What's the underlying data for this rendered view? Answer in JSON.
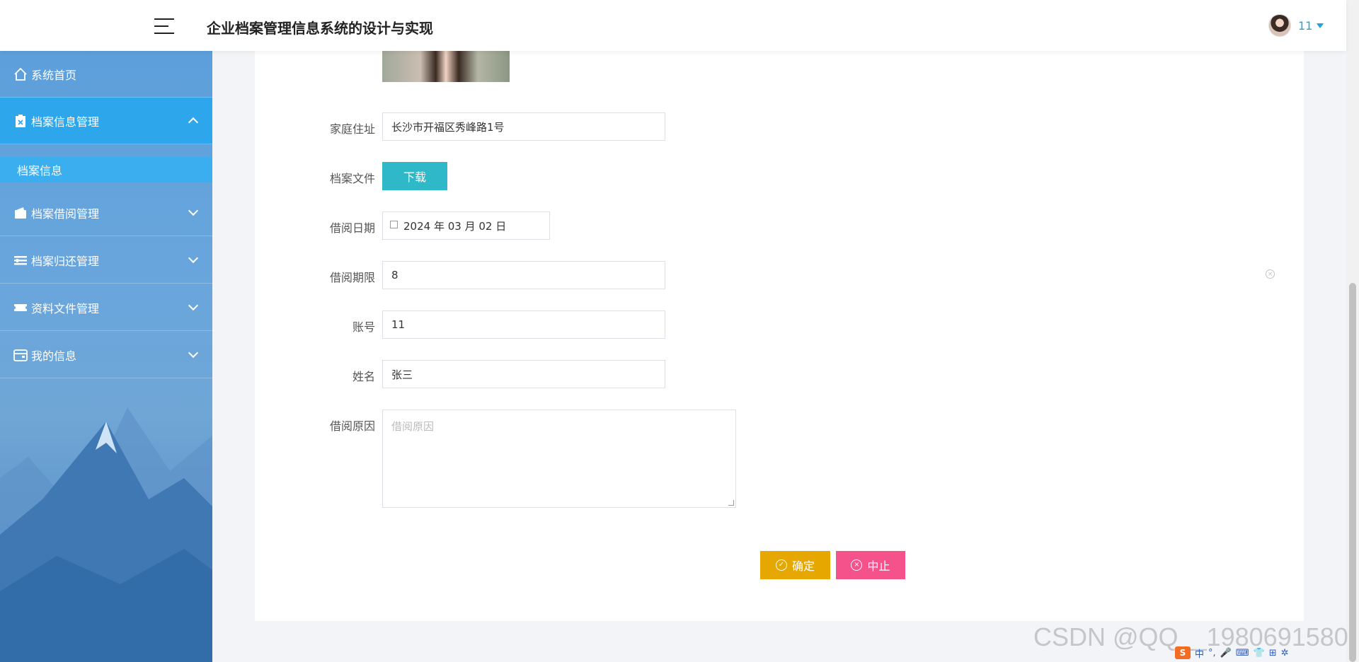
{
  "header": {
    "title": "企业档案管理信息系统的设计与实现",
    "username": "11"
  },
  "sidebar": {
    "items": [
      {
        "label": "系统首页",
        "icon": "home-icon"
      },
      {
        "label": "档案信息管理",
        "icon": "clipboard-icon",
        "expanded": true
      },
      {
        "label": "档案借阅管理",
        "icon": "wallet-icon"
      },
      {
        "label": "档案归还管理",
        "icon": "list-icon"
      },
      {
        "label": "资料文件管理",
        "icon": "ticket-icon"
      },
      {
        "label": "我的信息",
        "icon": "card-icon"
      }
    ],
    "sub_items": [
      {
        "label": "档案信息",
        "active": true
      }
    ]
  },
  "form": {
    "address_label": "家庭住址",
    "address_value": "长沙市开福区秀峰路1号",
    "file_label": "档案文件",
    "download_label": "下载",
    "borrow_date_label": "借阅日期",
    "borrow_date_value": "2024 年 03 月 02 日",
    "borrow_period_label": "借阅期限",
    "borrow_period_value": "8",
    "account_label": "账号",
    "account_value": "11",
    "name_label": "姓名",
    "name_value": "张三",
    "reason_label": "借阅原因",
    "reason_placeholder": "借阅原因"
  },
  "buttons": {
    "confirm": "确定",
    "stop": "中止"
  },
  "watermark": "CSDN @QQ__1980691580",
  "tray": {
    "ime_label": "中"
  },
  "colors": {
    "accent": "#2ea6ec",
    "confirm": "#e6a800",
    "stop": "#f5528b",
    "download": "#2eb8c8"
  }
}
